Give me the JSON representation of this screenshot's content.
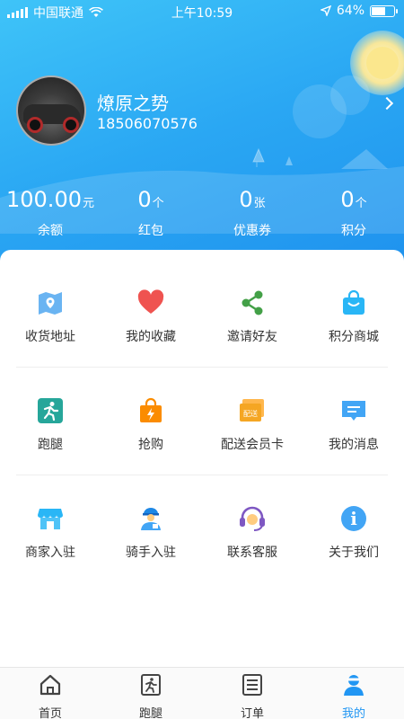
{
  "status_bar": {
    "carrier": "中国联通",
    "time": "上午10:59",
    "battery": "64%",
    "battery_level": 0.64
  },
  "profile": {
    "name": "燎原之势",
    "phone": "18506070576"
  },
  "stats": [
    {
      "value": "100.00",
      "unit": "元",
      "label": "余额"
    },
    {
      "value": "0",
      "unit": "个",
      "label": "红包"
    },
    {
      "value": "0",
      "unit": "张",
      "label": "优惠券"
    },
    {
      "value": "0",
      "unit": "个",
      "label": "积分"
    }
  ],
  "menu": [
    {
      "label": "收货地址",
      "icon": "map-pin-icon"
    },
    {
      "label": "我的收藏",
      "icon": "heart-icon"
    },
    {
      "label": "邀请好友",
      "icon": "share-icon"
    },
    {
      "label": "积分商城",
      "icon": "shopping-bag-icon"
    },
    {
      "label": "跑腿",
      "icon": "runner-icon"
    },
    {
      "label": "抢购",
      "icon": "flash-bag-icon"
    },
    {
      "label": "配送会员卡",
      "icon": "delivery-card-icon",
      "badge": "配送"
    },
    {
      "label": "我的消息",
      "icon": "message-icon"
    },
    {
      "label": "商家入驻",
      "icon": "store-icon"
    },
    {
      "label": "骑手入驻",
      "icon": "rider-icon"
    },
    {
      "label": "联系客服",
      "icon": "headset-icon"
    },
    {
      "label": "关于我们",
      "icon": "info-icon",
      "glyph": "i"
    }
  ],
  "tabs": [
    {
      "label": "首页",
      "icon": "home-icon"
    },
    {
      "label": "跑腿",
      "icon": "errand-icon"
    },
    {
      "label": "订单",
      "icon": "order-icon"
    },
    {
      "label": "我的",
      "icon": "user-icon"
    }
  ],
  "colors": {
    "accent": "#2196f3",
    "header_start": "#3fc4f8",
    "header_end": "#1f92ee"
  }
}
